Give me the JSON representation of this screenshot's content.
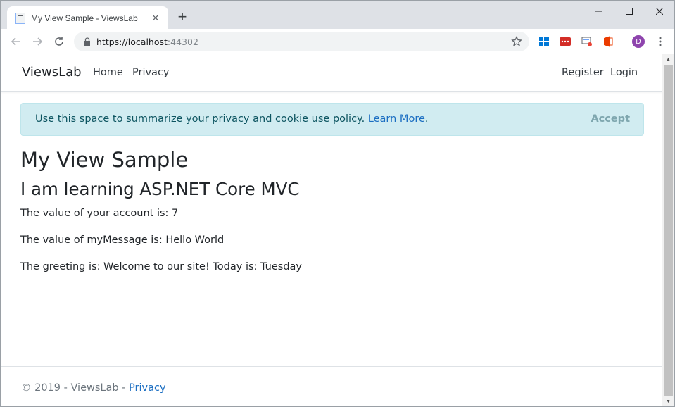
{
  "browser": {
    "tab_title": "My View Sample - ViewsLab",
    "tab_close": "✕",
    "new_tab": "+",
    "url_host": "https://localhost",
    "url_port": ":44302",
    "profile_initial": "D",
    "window": {
      "minimize": "—",
      "maximize": "☐",
      "close": "✕"
    }
  },
  "navbar": {
    "brand": "ViewsLab",
    "links": [
      "Home",
      "Privacy"
    ],
    "right_links": [
      "Register",
      "Login"
    ]
  },
  "cookie_banner": {
    "message": "Use this space to summarize your privacy and cookie use policy.",
    "learn_more": "Learn More",
    "period": ".",
    "accept": "Accept"
  },
  "content": {
    "heading": "My View Sample",
    "subheading": "I am learning ASP.NET Core MVC",
    "lines": [
      "The value of your account is: 7",
      "The value of myMessage is: Hello World",
      "The greeting is: Welcome to our site! Today is: Tuesday"
    ]
  },
  "footer": {
    "text": "© 2019 - ViewsLab - ",
    "privacy_link": "Privacy"
  },
  "colors": {
    "link": "#1b6ec2",
    "alert_bg": "#d1ecf1",
    "alert_text": "#0c5460",
    "avatar": "#8e44ad"
  }
}
